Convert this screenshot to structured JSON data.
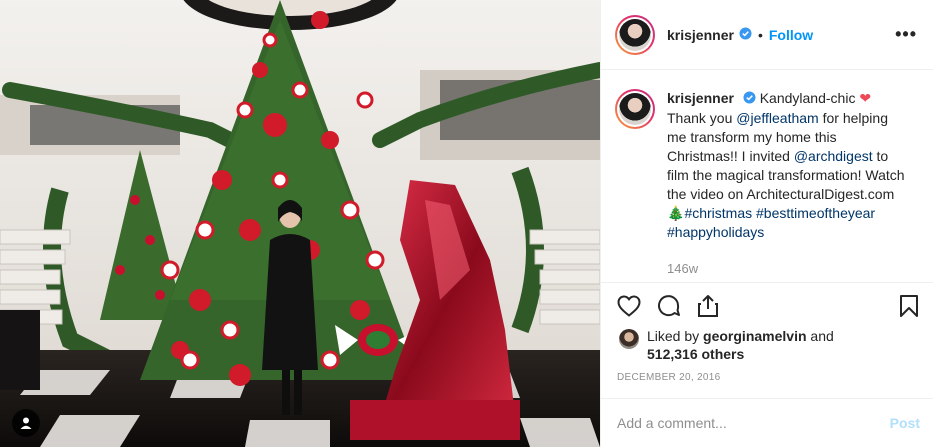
{
  "post": {
    "username": "krisjenner",
    "follow_label": "Follow",
    "more_label": "•••",
    "caption_parts": [
      {
        "t": "Kandyland-chic ",
        "hl": false
      },
      {
        "t": "❤",
        "hl": false,
        "heart": true
      },
      {
        "t": " Thank you ",
        "hl": false
      },
      {
        "t": "@jeffleatham",
        "hl": true
      },
      {
        "t": " for helping me transform my home this Christmas!! I invited ",
        "hl": false
      },
      {
        "t": "@archdigest",
        "hl": true
      },
      {
        "t": " to film the magical transformation! Watch the video on ArchitecturalDigest.com ",
        "hl": false
      },
      {
        "t": "🎄",
        "hl": false,
        "tree": true
      },
      {
        "t": "#christmas",
        "hl": true
      },
      {
        "t": " ",
        "hl": false
      },
      {
        "t": "#besttimeoftheyear",
        "hl": true
      },
      {
        "t": " ",
        "hl": false
      },
      {
        "t": "#happyholidays",
        "hl": true
      }
    ],
    "caption_age": "146w",
    "likes": {
      "prefix": "Liked by ",
      "user": "georginamelvin",
      "middle": " and",
      "count": "512,316 others"
    },
    "date": "DECEMBER 20, 2016",
    "comment_placeholder": "Add a comment...",
    "post_label": "Post"
  },
  "icons": {
    "verified": "verified-badge-icon",
    "like": "heart-icon",
    "comment": "comment-icon",
    "share": "share-icon",
    "save": "bookmark-icon",
    "tag": "user-tag-icon"
  },
  "colors": {
    "link": "#003569",
    "follow": "#0095f6",
    "muted": "#8e8e8e",
    "post_disabled": "#b2dffc",
    "heart": "#ed4956"
  }
}
